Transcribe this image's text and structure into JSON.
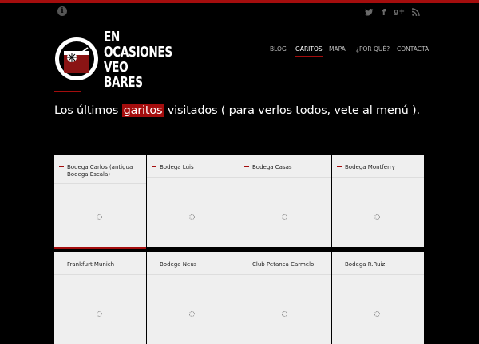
{
  "logo": {
    "lines": [
      "EN",
      "OCASIONES",
      "VEO",
      "BARES"
    ]
  },
  "social_icons": [
    "twitter-icon",
    "facebook-icon",
    "google-plus-icon",
    "rss-icon"
  ],
  "icons_glyphs": {
    "info": "i",
    "twitter": "t",
    "facebook": "f",
    "google": "g+",
    "rss": "◔"
  },
  "nav": {
    "items": [
      "BLOG",
      "GARITOS",
      "MAPA",
      "¿POR QUÉ?",
      "CONTACTA"
    ],
    "active": "GARITOS"
  },
  "headline": {
    "before": "Los últimos ",
    "highlight": "garitos",
    "after": " visitados ( para verlos todos, vete al menú )."
  },
  "cards": [
    "Bodega Carlos (antigua Bodega Escala)",
    "Bodega Luis",
    "Bodega Casas",
    "Bodega Montferry",
    "Frankfurt Munich",
    "Bodega Neus",
    "Club Petanca Carmelo",
    "Bodega R.Ruiz"
  ],
  "colors": {
    "accent": "#a40d0d",
    "background": "#000000",
    "card": "#efefef"
  }
}
